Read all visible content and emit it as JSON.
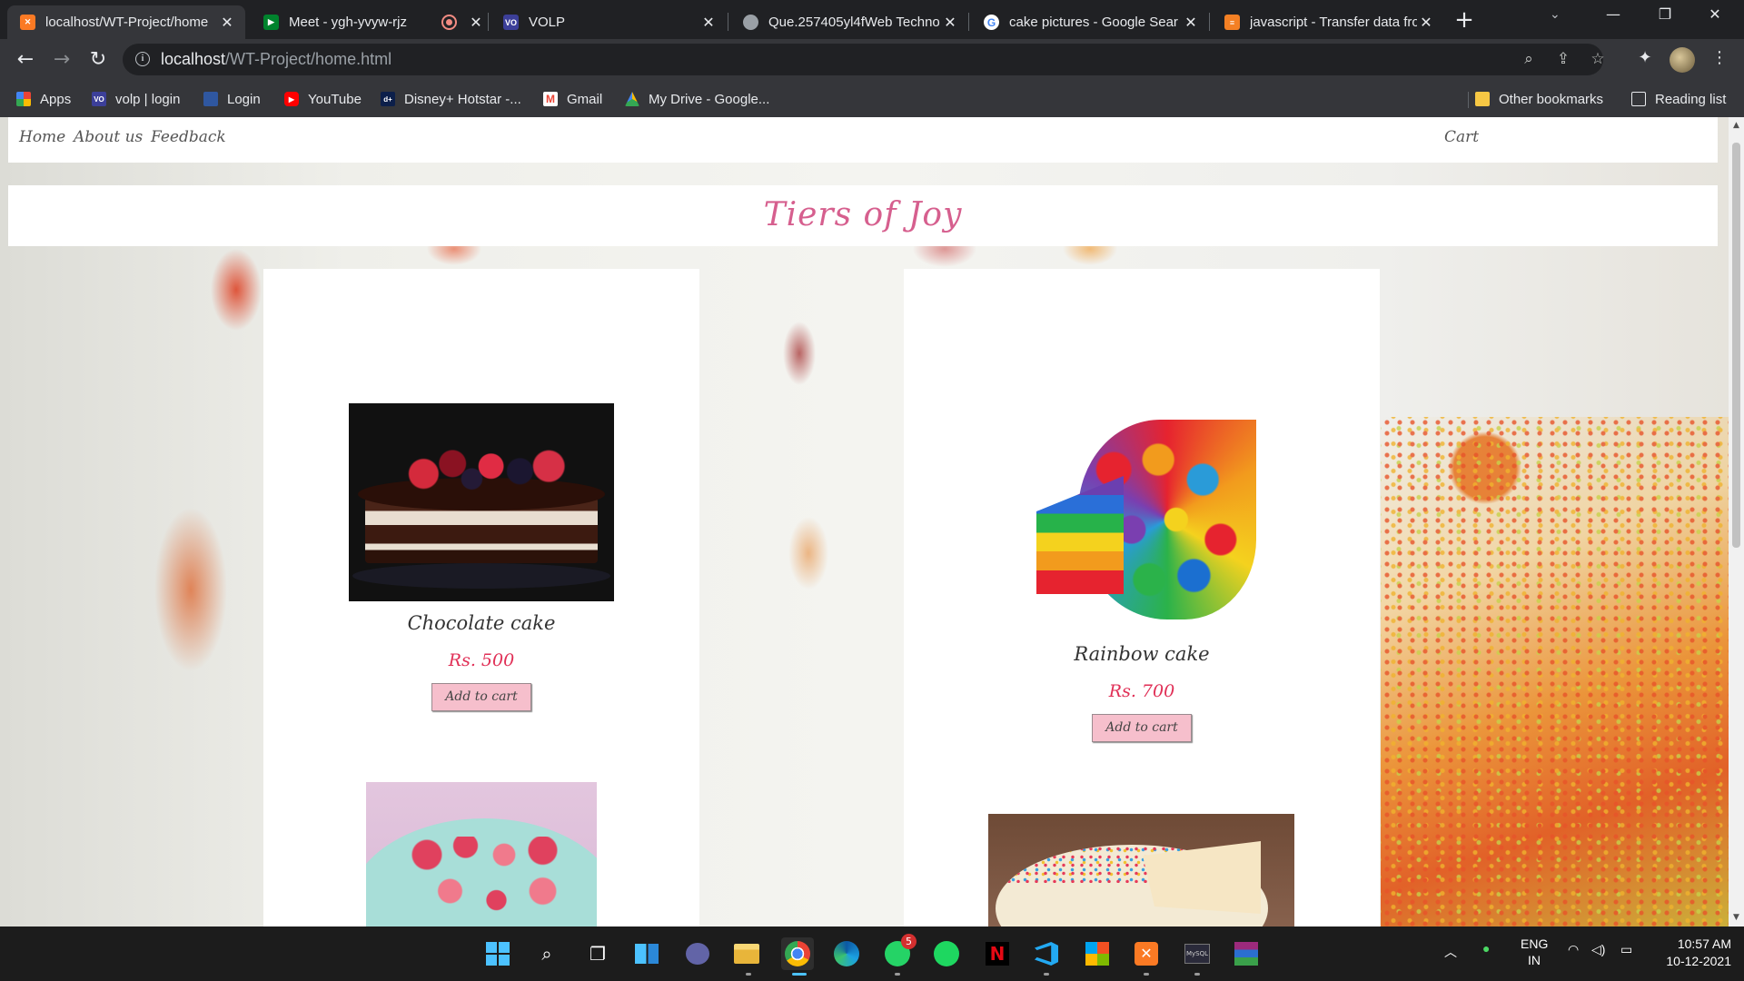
{
  "browser": {
    "tabs": [
      {
        "title": "localhost/WT-Project/home",
        "favicon": "xampp-icon",
        "color": "#fb7a24",
        "active": true
      },
      {
        "title": "Meet - ygh-yvyw-rjz",
        "favicon": "meet-icon",
        "color": "#00832d"
      },
      {
        "title": "",
        "favicon": "record-icon",
        "color": "#f28b82"
      },
      {
        "title": "VOLP",
        "favicon": "volp-icon",
        "color": "#3c3f99"
      },
      {
        "title": "Que.257405yl4fWeb Techno",
        "favicon": "globe-icon",
        "color": "#9aa0a6"
      },
      {
        "title": "cake pictures - Google Sear",
        "favicon": "google-icon",
        "color": "#4285f4"
      },
      {
        "title": "javascript - Transfer data fro",
        "favicon": "stackoverflow-icon",
        "color": "#f48024"
      }
    ],
    "url_host": "localhost",
    "url_path": "/WT-Project/home.html",
    "bookmarks": [
      {
        "label": "Apps",
        "icon": "apps-grid-icon",
        "color": "#4285f4"
      },
      {
        "label": "volp | login",
        "icon": "volp-icon",
        "color": "#3c3f99"
      },
      {
        "label": "Login",
        "icon": "login-icon",
        "color": "#2f57a0"
      },
      {
        "label": "YouTube",
        "icon": "youtube-icon",
        "color": "#ff0000"
      },
      {
        "label": "Disney+ Hotstar -...",
        "icon": "hotstar-icon",
        "color": "#0c1f4a"
      },
      {
        "label": "Gmail",
        "icon": "gmail-icon",
        "color": "#ea4335"
      },
      {
        "label": "My Drive - Google...",
        "icon": "drive-icon",
        "color": "#fbbc04"
      }
    ],
    "other_bookmarks": "Other bookmarks",
    "reading_list": "Reading list"
  },
  "site": {
    "nav": {
      "home": "Home",
      "about": "About us",
      "feedback": "Feedback",
      "cart": "Cart"
    },
    "title": "Tiers of Joy",
    "products": [
      {
        "name": "Chocolate cake",
        "price": "Rs. 500",
        "button": "Add to cart"
      },
      {
        "name": "Rainbow cake",
        "price": "Rs. 700",
        "button": "Add to cart"
      }
    ]
  },
  "taskbar": {
    "apps": [
      "windows-start-icon",
      "search-icon",
      "task-view-icon",
      "widgets-icon",
      "teams-chat-icon",
      "file-explorer-icon",
      "chrome-icon",
      "edge-icon",
      "whatsapp-icon",
      "spotify-icon",
      "netflix-icon",
      "vscode-icon",
      "office-icon",
      "xampp-icon",
      "mysql-icon",
      "winrar-icon"
    ],
    "whatsapp_badge": "5",
    "lang_top": "ENG",
    "lang_bottom": "IN",
    "time": "10:57 AM",
    "date": "10-12-2021"
  }
}
